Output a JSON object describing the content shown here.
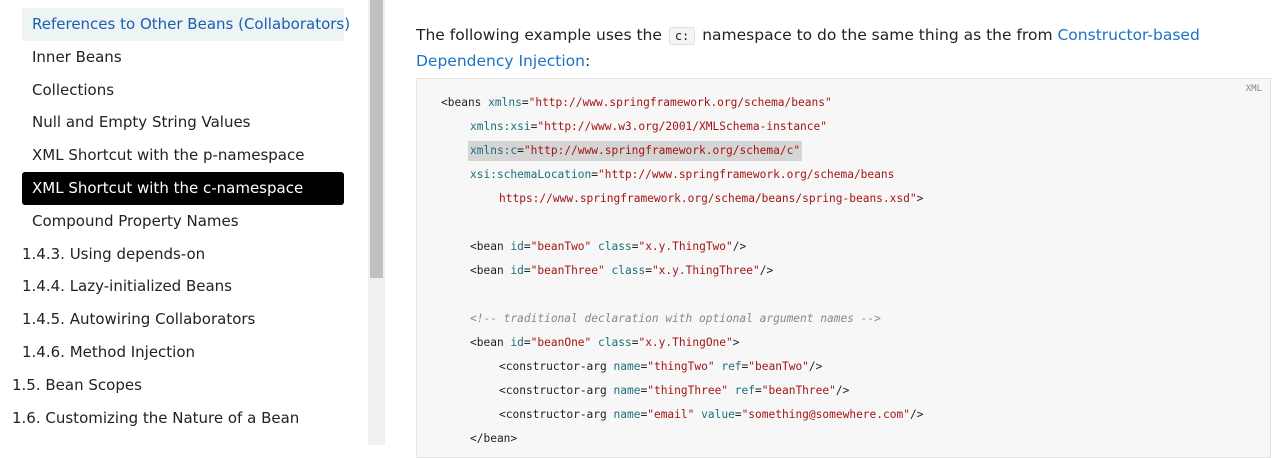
{
  "sidebar": {
    "items": [
      {
        "label": "References to Other Beans (Collaborators)",
        "level": 3,
        "state": "hover"
      },
      {
        "label": "Inner Beans",
        "level": 3,
        "state": ""
      },
      {
        "label": "Collections",
        "level": 3,
        "state": ""
      },
      {
        "label": "Null and Empty String Values",
        "level": 3,
        "state": ""
      },
      {
        "label": "XML Shortcut with the p-namespace",
        "level": 3,
        "state": ""
      },
      {
        "label": "XML Shortcut with the c-namespace",
        "level": 3,
        "state": "active"
      },
      {
        "label": "Compound Property Names",
        "level": 3,
        "state": ""
      },
      {
        "label": "1.4.3. Using depends-on",
        "level": 2,
        "state": ""
      },
      {
        "label": "1.4.4. Lazy-initialized Beans",
        "level": 2,
        "state": ""
      },
      {
        "label": "1.4.5. Autowiring Collaborators",
        "level": 2,
        "state": ""
      },
      {
        "label": "1.4.6. Method Injection",
        "level": 2,
        "state": ""
      },
      {
        "label": "1.5. Bean Scopes",
        "level": 1,
        "state": ""
      },
      {
        "label": "1.6. Customizing the Nature of a Bean",
        "level": 1,
        "state": ""
      }
    ]
  },
  "main": {
    "intro": {
      "before": "The following example uses the",
      "code": "c:",
      "middle": "namespace to do the same thing as the from",
      "link": "Constructor-based Dependency Injection",
      "after": ":"
    },
    "code_lang": "XML",
    "code_lines": [
      {
        "indent": 0,
        "highlight": false,
        "tokens": [
          {
            "t": "tag",
            "v": "<beans "
          },
          {
            "t": "attr",
            "v": "xmlns"
          },
          {
            "t": "tag",
            "v": "="
          },
          {
            "t": "str",
            "v": "\"http://www.springframework.org/schema/beans\""
          }
        ]
      },
      {
        "indent": 1,
        "highlight": false,
        "tokens": [
          {
            "t": "attr",
            "v": "xmlns:xsi"
          },
          {
            "t": "tag",
            "v": "="
          },
          {
            "t": "str",
            "v": "\"http://www.w3.org/2001/XMLSchema-instance\""
          }
        ]
      },
      {
        "indent": 1,
        "highlight": true,
        "tokens": [
          {
            "t": "attr",
            "v": "xmlns:c"
          },
          {
            "t": "tag",
            "v": "="
          },
          {
            "t": "str",
            "v": "\"http://www.springframework.org/schema/c\""
          }
        ]
      },
      {
        "indent": 1,
        "highlight": false,
        "tokens": [
          {
            "t": "attr",
            "v": "xsi:schemaLocation"
          },
          {
            "t": "tag",
            "v": "="
          },
          {
            "t": "str",
            "v": "\"http://www.springframework.org/schema/beans"
          }
        ]
      },
      {
        "indent": 2,
        "highlight": false,
        "tokens": [
          {
            "t": "str",
            "v": "https://www.springframework.org/schema/beans/spring-beans.xsd\""
          },
          {
            "t": "tag",
            "v": ">"
          }
        ]
      },
      {
        "indent": 0,
        "highlight": false,
        "tokens": []
      },
      {
        "indent": 1,
        "highlight": false,
        "tokens": [
          {
            "t": "tag",
            "v": "<bean "
          },
          {
            "t": "attr",
            "v": "id"
          },
          {
            "t": "tag",
            "v": "="
          },
          {
            "t": "str",
            "v": "\"beanTwo\""
          },
          {
            "t": "tag",
            "v": " "
          },
          {
            "t": "attr",
            "v": "class"
          },
          {
            "t": "tag",
            "v": "="
          },
          {
            "t": "str",
            "v": "\"x.y.ThingTwo\""
          },
          {
            "t": "tag",
            "v": "/>"
          }
        ]
      },
      {
        "indent": 1,
        "highlight": false,
        "tokens": [
          {
            "t": "tag",
            "v": "<bean "
          },
          {
            "t": "attr",
            "v": "id"
          },
          {
            "t": "tag",
            "v": "="
          },
          {
            "t": "str",
            "v": "\"beanThree\""
          },
          {
            "t": "tag",
            "v": " "
          },
          {
            "t": "attr",
            "v": "class"
          },
          {
            "t": "tag",
            "v": "="
          },
          {
            "t": "str",
            "v": "\"x.y.ThingThree\""
          },
          {
            "t": "tag",
            "v": "/>"
          }
        ]
      },
      {
        "indent": 0,
        "highlight": false,
        "tokens": []
      },
      {
        "indent": 1,
        "highlight": false,
        "tokens": [
          {
            "t": "cm",
            "v": "<!-- traditional declaration with optional argument names -->"
          }
        ]
      },
      {
        "indent": 1,
        "highlight": false,
        "tokens": [
          {
            "t": "tag",
            "v": "<bean "
          },
          {
            "t": "attr",
            "v": "id"
          },
          {
            "t": "tag",
            "v": "="
          },
          {
            "t": "str",
            "v": "\"beanOne\""
          },
          {
            "t": "tag",
            "v": " "
          },
          {
            "t": "attr",
            "v": "class"
          },
          {
            "t": "tag",
            "v": "="
          },
          {
            "t": "str",
            "v": "\"x.y.ThingOne\""
          },
          {
            "t": "tag",
            "v": ">"
          }
        ]
      },
      {
        "indent": 2,
        "highlight": false,
        "tokens": [
          {
            "t": "tag",
            "v": "<constructor-arg "
          },
          {
            "t": "attr",
            "v": "name"
          },
          {
            "t": "tag",
            "v": "="
          },
          {
            "t": "str",
            "v": "\"thingTwo\""
          },
          {
            "t": "tag",
            "v": " "
          },
          {
            "t": "attr",
            "v": "ref"
          },
          {
            "t": "tag",
            "v": "="
          },
          {
            "t": "str",
            "v": "\"beanTwo\""
          },
          {
            "t": "tag",
            "v": "/>"
          }
        ]
      },
      {
        "indent": 2,
        "highlight": false,
        "tokens": [
          {
            "t": "tag",
            "v": "<constructor-arg "
          },
          {
            "t": "attr",
            "v": "name"
          },
          {
            "t": "tag",
            "v": "="
          },
          {
            "t": "str",
            "v": "\"thingThree\""
          },
          {
            "t": "tag",
            "v": " "
          },
          {
            "t": "attr",
            "v": "ref"
          },
          {
            "t": "tag",
            "v": "="
          },
          {
            "t": "str",
            "v": "\"beanThree\""
          },
          {
            "t": "tag",
            "v": "/>"
          }
        ]
      },
      {
        "indent": 2,
        "highlight": false,
        "tokens": [
          {
            "t": "tag",
            "v": "<constructor-arg "
          },
          {
            "t": "attr",
            "v": "name"
          },
          {
            "t": "tag",
            "v": "="
          },
          {
            "t": "str",
            "v": "\"email\""
          },
          {
            "t": "tag",
            "v": " "
          },
          {
            "t": "attr",
            "v": "value"
          },
          {
            "t": "tag",
            "v": "="
          },
          {
            "t": "str",
            "v": "\"something@somewhere.com\""
          },
          {
            "t": "tag",
            "v": "/>"
          }
        ]
      },
      {
        "indent": 1,
        "highlight": false,
        "tokens": [
          {
            "t": "tag",
            "v": "</bean>"
          }
        ]
      }
    ]
  },
  "colors": {
    "link": "#1a73c7",
    "active_bg": "#000000",
    "hover_bg": "#eef3f3",
    "code_bg": "#f7f7f7",
    "code_tag": "#222222",
    "code_attr": "#1b6f7a",
    "code_string": "#a31515",
    "code_comment": "#888888"
  }
}
